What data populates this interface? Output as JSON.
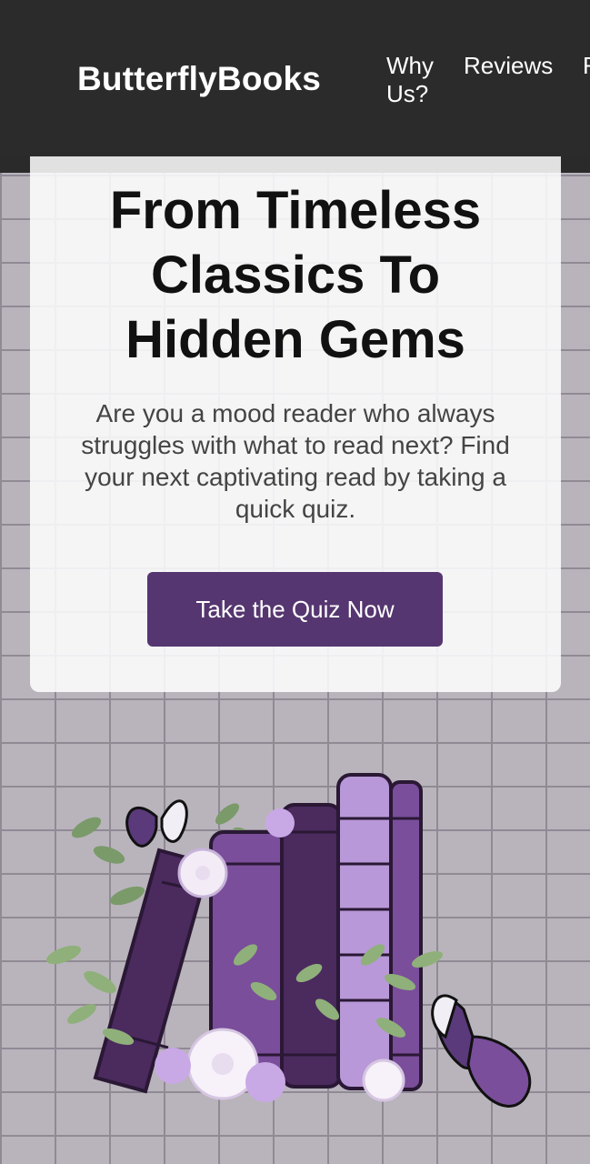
{
  "header": {
    "brand": "ButterflyBooks",
    "nav": [
      "Why Us?",
      "Reviews",
      "F"
    ]
  },
  "hero": {
    "title": "From Timeless Classics To Hidden Gems",
    "description": "Are you a mood reader who always struggles with what to read next? Find your next captivating read by taking a quick quiz.",
    "cta_label": "Take the Quiz Now"
  },
  "colors": {
    "header_bg": "#2b2b2b",
    "accent": "#553670",
    "wall": "#b9b4bc"
  },
  "icons": [
    "butterfly-icon",
    "books-illustration",
    "flower-icon",
    "leaf-icon"
  ]
}
